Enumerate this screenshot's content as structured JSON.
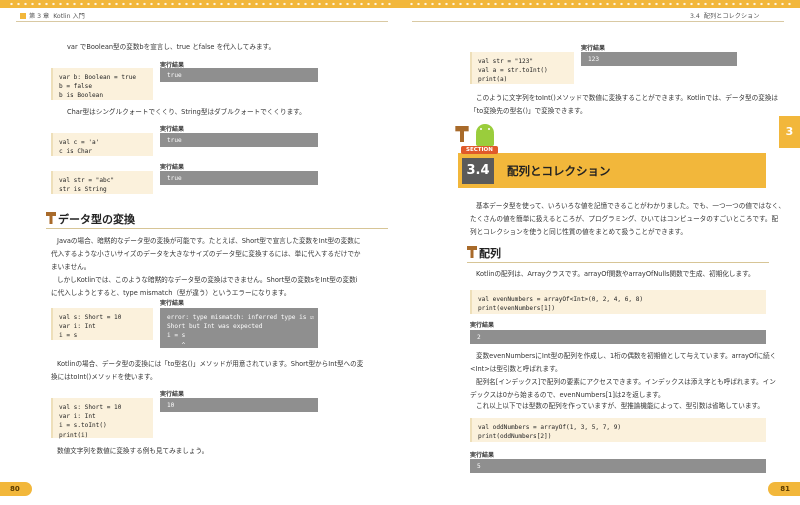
{
  "header": {
    "left_chapter": "第 3 章",
    "left_title": "Kotlin 入門",
    "right_section": "3.4",
    "right_title": "配列とコレクション"
  },
  "left_page": {
    "intro": "var でBoolean型の変数bを宣言し、true とfalse を代入してみます。",
    "bool_label": "実行結果",
    "bool_code": "var b: Boolean = true\nb = false\nb is Boolean",
    "bool_out": "true",
    "char_text": "Char型はシングルクォートでくくり、String型はダブルクォートでくくります。",
    "char_label": "実行結果",
    "char_code": "val c = 'a'\nc is Char",
    "char_out": "true",
    "str_label": "実行結果",
    "str_code": "val str = \"abc\"\nstr is String",
    "str_out": "true",
    "conv_heading": "データ型の変換",
    "conv_p1_l1": "Javaの場合、暗黙的なデータ型の変換が可能です。たとえば、Short型で宣言した変数をInt型の変数に",
    "conv_p1_l2": "代入するような小さいサイズのデータを大きなサイズのデータ型に変換するには、単に代入するだけでか",
    "conv_p1_l3": "まいません。",
    "conv_p2_l1": "しかしKotlinでは、このような暗黙的なデータ型の変換はできません。Short型の変数sをInt型の変数i",
    "conv_p2_l2": "に代入しようとすると、type mismatch（型が違う）というエラーになります。",
    "err_label": "実行結果",
    "err_code": "val s: Short = 10\nvar i: Int\ni = s",
    "err_out": "error: type mismatch: inferred type is ☑\nShort but Int was expected\ni = s\n    ^",
    "to_p_l1": "Kotlinの場合、データ型の変換には「to型名()」メソッドが用意されています。Short型からInt型への変",
    "to_p_l2": "換にはtoInt()メソッドを使います。",
    "toint_label": "実行結果",
    "toint_code": "val s: Short = 10\nvar i: Int\ni = s.toInt()\nprint(i)",
    "toint_out": "10",
    "bottom_text": "数値文字列を数値に変換する例も見てみましょう。",
    "page_number": "80"
  },
  "right_page": {
    "top_label": "実行結果",
    "top_code": "val str = \"123\"\nval a = str.toInt()\nprint(a)",
    "top_out": "123",
    "top_p_l1": "このように文字列をtoInt()メソッドで数値に変換することができます。Kotlinでは、データ型の変換は",
    "top_p_l2": "「to変換先の型名()」で変換できます。",
    "section_badge": "SECTION",
    "section_number": "3.4",
    "section_title": "配列とコレクション",
    "sec_p_l1": "基本データ型を使って、いろいろな値を記憶できることがわかりました。でも、一つ一つの値ではなく、",
    "sec_p_l2": "たくさんの値を簡単に扱えるところが、プログラミング、ひいてはコンピュータのすごいところです。配",
    "sec_p_l3": "列とコレクションを使うと同じ性質の値をまとめて扱うことができます。",
    "array_heading": "配列",
    "array_p": "Kotlinの配列は、Arrayクラスです。arrayOf関数やarrayOfNulls関数で生成、初期化します。",
    "even_code": "val evenNumbers = arrayOf<Int>(0, 2, 4, 6, 8)\nprint(evenNumbers[1])",
    "even_label": "実行結果",
    "even_out": "2",
    "desc_l1": "変数evenNumbersにInt型の配列を作成し、1桁の偶数を初期値として与えています。arrayOfに続く",
    "desc_l2": "<Int>は型引数と呼ばれます。",
    "desc_l3": "配列名[インデックス]で配列の要素にアクセスできます。インデックスは添え字とも呼ばれます。イン",
    "desc_l4": "デックスは0から始まるので、evenNumbers[1]は2を返します。",
    "desc_l5": "これ以上以下では型数の配列を作っていますが、型推論機能によって、型引数は省略しています。",
    "odd_code": "val oddNumbers = arrayOf(1, 3, 5, 7, 9)\nprint(oddNumbers[2])",
    "odd_label": "実行結果",
    "odd_out": "5",
    "side_tab": "3",
    "page_number": "81"
  },
  "colors": {
    "accent": "#f2b73b",
    "output_bg": "#8f8f8f",
    "code_bg": "#fbf1dc",
    "section_dark": "#5a5a5a"
  }
}
